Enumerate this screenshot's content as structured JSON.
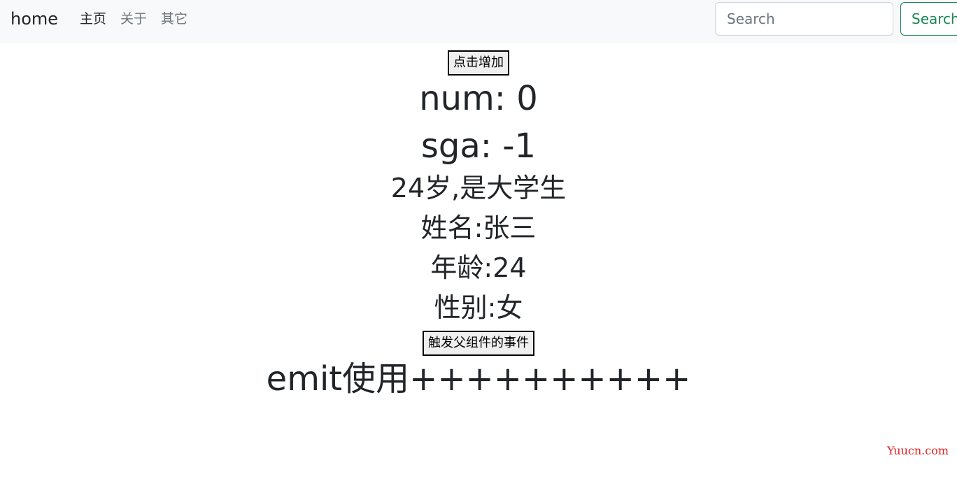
{
  "navbar": {
    "brand": "home",
    "links": [
      {
        "label": "主页",
        "active": true
      },
      {
        "label": "关于",
        "active": false
      },
      {
        "label": "其它",
        "active": false
      }
    ],
    "search": {
      "placeholder": "Search",
      "value": "",
      "button_label": "Search"
    }
  },
  "main": {
    "add_button_label": "点击增加",
    "num_text": "num: 0",
    "sga_text": "sga: -1",
    "info_text": "24岁,是大学生",
    "name_text": "姓名:张三",
    "age_text": "年龄:24",
    "sex_text": "性别:女",
    "emit_button_label": "触发父组件的事件",
    "emit_text": "emit使用++++++++++"
  },
  "watermark": "Yuucn.com",
  "colors": {
    "navbar_bg": "#f8f9fa",
    "search_button": "#198754",
    "watermark": "#e02020"
  }
}
